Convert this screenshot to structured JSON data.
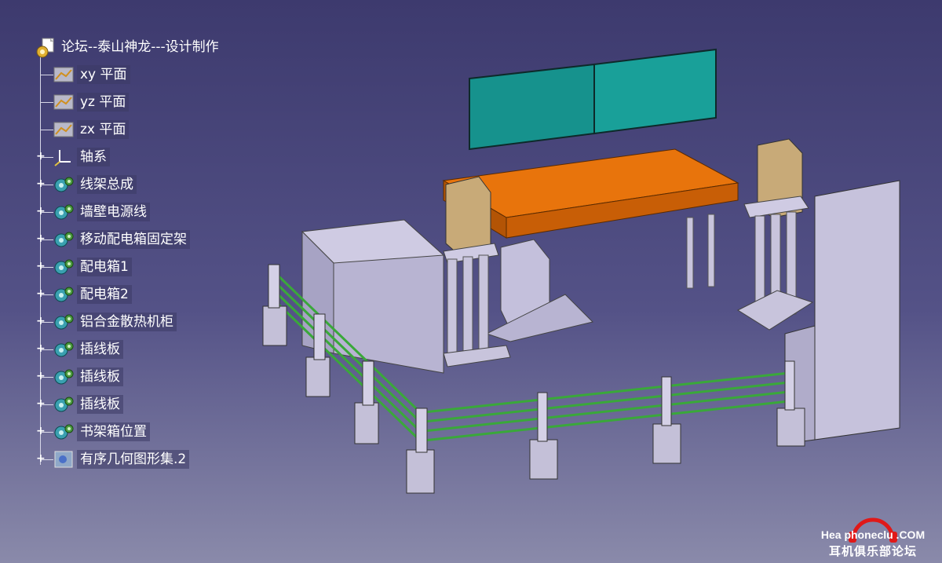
{
  "tree": {
    "root": "论坛--泰山神龙---设计制作",
    "items": [
      {
        "label": "xy 平面",
        "icon": "plane-icon",
        "expandable": false
      },
      {
        "label": "yz 平面",
        "icon": "plane-icon",
        "expandable": false
      },
      {
        "label": "zx 平面",
        "icon": "plane-icon",
        "expandable": false
      },
      {
        "label": "轴系",
        "icon": "axis-system-icon",
        "expandable": true
      },
      {
        "label": "线架总成",
        "icon": "part-icon",
        "expandable": true
      },
      {
        "label": "墙壁电源线",
        "icon": "part-icon",
        "expandable": true
      },
      {
        "label": "移动配电箱固定架",
        "icon": "part-icon",
        "expandable": true
      },
      {
        "label": "配电箱1",
        "icon": "part-icon",
        "expandable": true
      },
      {
        "label": "配电箱2",
        "icon": "part-icon",
        "expandable": true
      },
      {
        "label": "铝合金散热机柜",
        "icon": "part-icon",
        "expandable": true
      },
      {
        "label": "插线板",
        "icon": "part-icon",
        "expandable": true
      },
      {
        "label": "插线板",
        "icon": "part-icon",
        "expandable": true
      },
      {
        "label": "插线板",
        "icon": "part-icon",
        "expandable": true
      },
      {
        "label": "书架箱位置",
        "icon": "part-icon",
        "expandable": true
      },
      {
        "label": "有序几何图形集.2",
        "icon": "geometric-set-icon",
        "expandable": true
      }
    ]
  },
  "watermark": {
    "line1": "HeadphoneclubCOM",
    "line1_display": "Hea  phoneclu  .COM",
    "line2": "耳机俱乐部论坛"
  },
  "colors": {
    "panel": "#1a9a94",
    "orange": "#e8740c",
    "box": "#c6c2dc",
    "wire": "#3aa83a",
    "tan": "#c8aa78"
  }
}
